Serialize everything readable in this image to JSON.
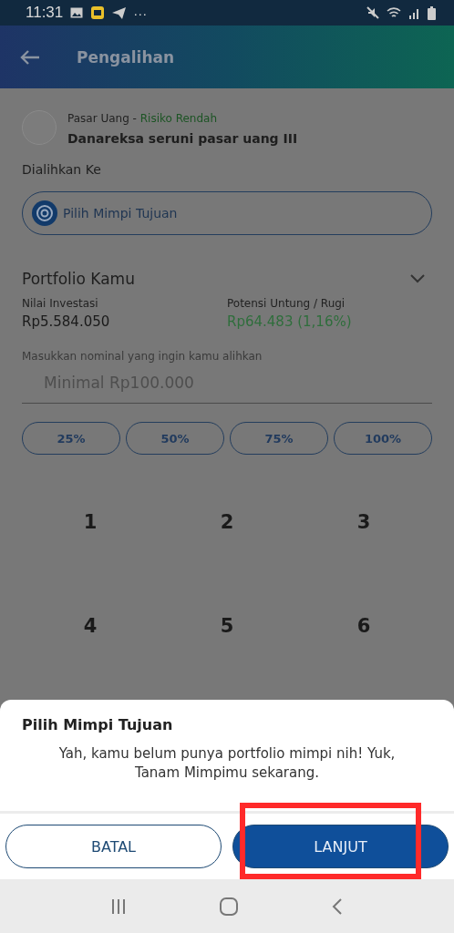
{
  "status_bar": {
    "time": "11:31",
    "notification_dots": "···"
  },
  "header": {
    "title": "Pengalihan"
  },
  "fund": {
    "category": "Pasar Uang",
    "separator": " - ",
    "risk": "Risiko Rendah",
    "name": "Danareksa seruni pasar uang III"
  },
  "transfer_to": {
    "label": "Dialihkan Ke",
    "button": "Pilih Mimpi Tujuan"
  },
  "portfolio": {
    "title": "Portfolio Kamu",
    "expanded": false,
    "stats": [
      {
        "label": "Nilai Investasi",
        "value": "Rp5.584.050",
        "kind": "neutral"
      },
      {
        "label": "Potensi Untung / Rugi",
        "value": "Rp64.483 (1,16%)",
        "kind": "gain"
      }
    ]
  },
  "amount": {
    "label": "Masukkan nominal yang ingin kamu alihkan",
    "placeholder": "Minimal Rp100.000"
  },
  "presets": [
    "25%",
    "50%",
    "75%",
    "100%"
  ],
  "keypad": [
    [
      "1",
      "2",
      "3"
    ],
    [
      "4",
      "5",
      "6"
    ]
  ],
  "dialog": {
    "title": "Pilih Mimpi Tujuan",
    "message": "Yah, kamu belum punya portfolio mimpi nih! Yuk, Tanam Mimpimu sekarang.",
    "buttons": [
      {
        "label": "BATAL",
        "kind": "outline",
        "highlighted": false
      },
      {
        "label": "LANJUT",
        "kind": "primary",
        "highlighted": true
      }
    ]
  }
}
